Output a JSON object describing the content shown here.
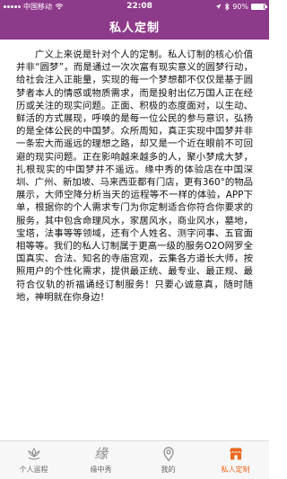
{
  "status_bar": {
    "carrier": "中国移动",
    "wifi_icon": "wifi-icon",
    "time": "22:08",
    "battery_percent": "90%",
    "battery_level": 0.9
  },
  "nav": {
    "title": "私人定制"
  },
  "content": {
    "paragraph": "广义上来说是针对个人的定制。私人订制的核心价值并非“圆梦”，而是通过一次次富有现实意义的圆梦行动，给社会注入正能量，实现的每一个梦想都不仅仅是基于圆梦者本人的情感或物质需求，而是投射出亿万国人正在经历或关注的现实问题。正面、积极的态度面对，以生动、鲜活的方式展现，呼唤的是每一位公民的参与意识，弘扬的是全体公民的中国梦。众所周知，真正实现中国梦并非一条宏大而遥远的理想之路，却又是一个近在眼前不可回避的现实问题。正在影响越来越多的人，聚小梦成大梦，扎根现实的中国梦并不遥远。缘中秀的体验店在中国深圳、广州、新加坡、马来西亚都有门店，更有360°的物品展示，大师空降分析当天的运程等不一样的体验，APP下单，根据你的个人需求专门为你定制适合你符合你要求的服务，其中包含命理风水，家居风水，商业风水，墓地，宝塔，法事等等领域，还有个人姓名、测字问事、五官面相等等。我们的私人订制属于更高一级的服务O2O网罗全国真实、合法、知名的寺庙宫观，云集各方道长大师，按照用户的个性化需求，提供最正统、最专业、最正规、最符合仪轨的祈福诵经订制服务！只要心诚意真，随时随地，神明就在你身边！"
  },
  "tabs": [
    {
      "label": "个人运程",
      "icon": "lotus-icon",
      "active": false
    },
    {
      "label": "缘中秀",
      "icon": "yuan-calligraphy-icon",
      "glyph": "缘",
      "active": false
    },
    {
      "label": "我的",
      "icon": "location-pin-icon",
      "active": false
    },
    {
      "label": "私人定制",
      "icon": "shop-icon",
      "active": true
    }
  ],
  "colors": {
    "header_bg": "#8e3a8a",
    "active_tab": "#e8681e",
    "inactive_tab": "#8a8a8a"
  }
}
